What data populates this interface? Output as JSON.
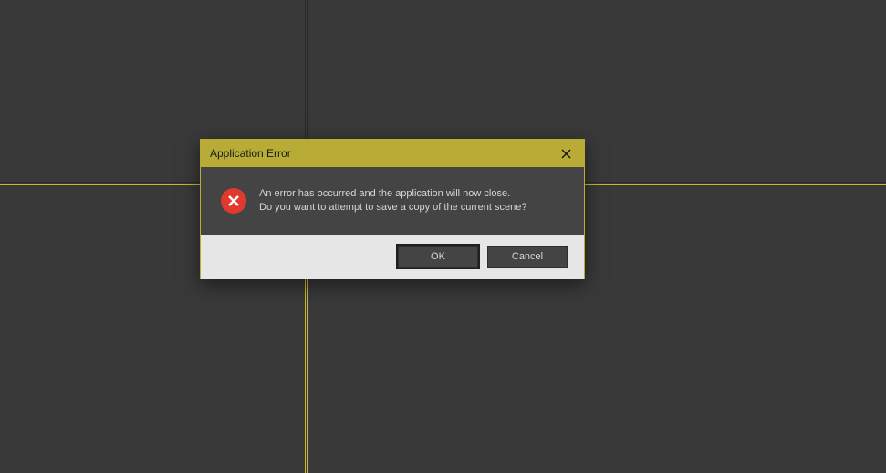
{
  "dialog": {
    "title": "Application Error",
    "message_line1": "An error has occurred and the application will now close.",
    "message_line2": "Do you want to attempt to save a copy of the current scene?",
    "ok_label": "OK",
    "cancel_label": "Cancel"
  }
}
